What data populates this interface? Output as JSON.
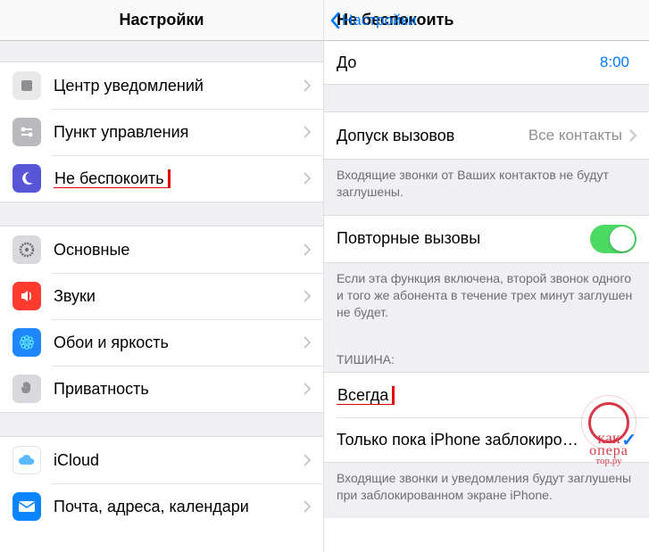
{
  "left": {
    "title": "Настройки",
    "groups": [
      [
        {
          "key": "notifications",
          "label": "Центр уведомлений",
          "iconBg": "#e9e9e9",
          "iconFg": "#8e8e93",
          "shape": "square"
        },
        {
          "key": "control-center",
          "label": "Пункт управления",
          "iconBg": "#c7c7cc",
          "iconFg": "#fff",
          "shape": "switches"
        },
        {
          "key": "dnd",
          "label": "Не беспокоить",
          "iconBg": "#5856d6",
          "iconFg": "#fff",
          "shape": "moon",
          "highlight": true
        }
      ],
      [
        {
          "key": "general",
          "label": "Основные",
          "iconBg": "#d1d1d6",
          "iconFg": "#6e6e73",
          "shape": "gear"
        },
        {
          "key": "sounds",
          "label": "Звуки",
          "iconBg": "#ff3b30",
          "iconFg": "#fff",
          "shape": "speaker"
        },
        {
          "key": "wallpaper",
          "label": "Обои и яркость",
          "iconBg": "#2e86ff",
          "iconFg": "#fff",
          "shape": "flower"
        },
        {
          "key": "privacy",
          "label": "Приватность",
          "iconBg": "#d1d1d6",
          "iconFg": "#8e8e93",
          "shape": "hand"
        }
      ],
      [
        {
          "key": "icloud",
          "label": "iCloud",
          "iconBg": "#e9f3ff",
          "iconFg": "#3ea9ff",
          "shape": "cloud"
        },
        {
          "key": "mail",
          "label": "Почта, адреса, календари",
          "iconBg": "#007aff",
          "iconFg": "#fff",
          "shape": "mail"
        }
      ]
    ]
  },
  "right": {
    "backLabel": "Настройки",
    "title": "Не беспокоить",
    "rows": {
      "until": {
        "label": "До",
        "value": "8:00"
      },
      "allowCalls": {
        "label": "Допуск вызовов",
        "value": "Все контакты"
      },
      "allowCallsFooter": "Входящие звонки от Ваших контактов не будут заглушены.",
      "repeatCalls": {
        "label": "Повторные вызовы"
      },
      "repeatFooter": "Если эта функция включена, второй звонок одного и того же абонента в течение трех минут заглушен не будет.",
      "silenceHeader": "ТИШИНА:",
      "always": "Всегда",
      "onlyLocked": "Только пока iPhone заблокиро…",
      "silenceFooter": "Входящие звонки и уведомления будут заглушены при заблокированном экране iPhone."
    }
  },
  "watermark": {
    "line1": "как",
    "line2": "опера",
    "line3": "тор.ру"
  }
}
